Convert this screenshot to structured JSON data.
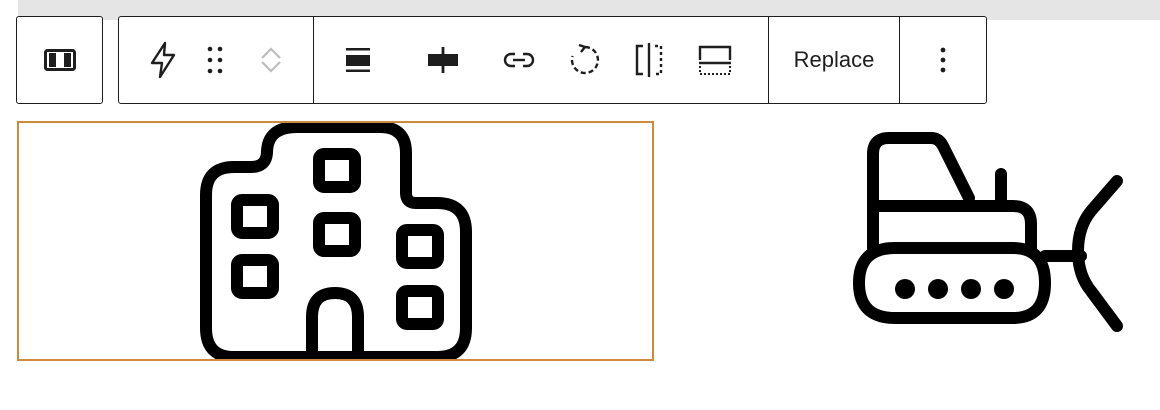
{
  "toolbar": {
    "parent_block_icon": "columns-icon",
    "transform_icon": "lightning-icon",
    "drag_icon": "drag-handle-icon",
    "move_up_icon": "chevron-up-icon",
    "move_down_icon": "chevron-down-icon",
    "align_icon": "align-wide-icon",
    "justify_icon": "justify-center-icon",
    "link_icon": "link-icon",
    "rotate_icon": "rotate-icon",
    "flip_icon": "flip-horizontal-icon",
    "caption_icon": "caption-icon",
    "replace_label": "Replace",
    "more_icon": "vertical-dots-icon"
  },
  "content": {
    "selected_icon": "building-icon",
    "second_icon": "bulldozer-icon",
    "selection_color": "#d08a3e"
  }
}
